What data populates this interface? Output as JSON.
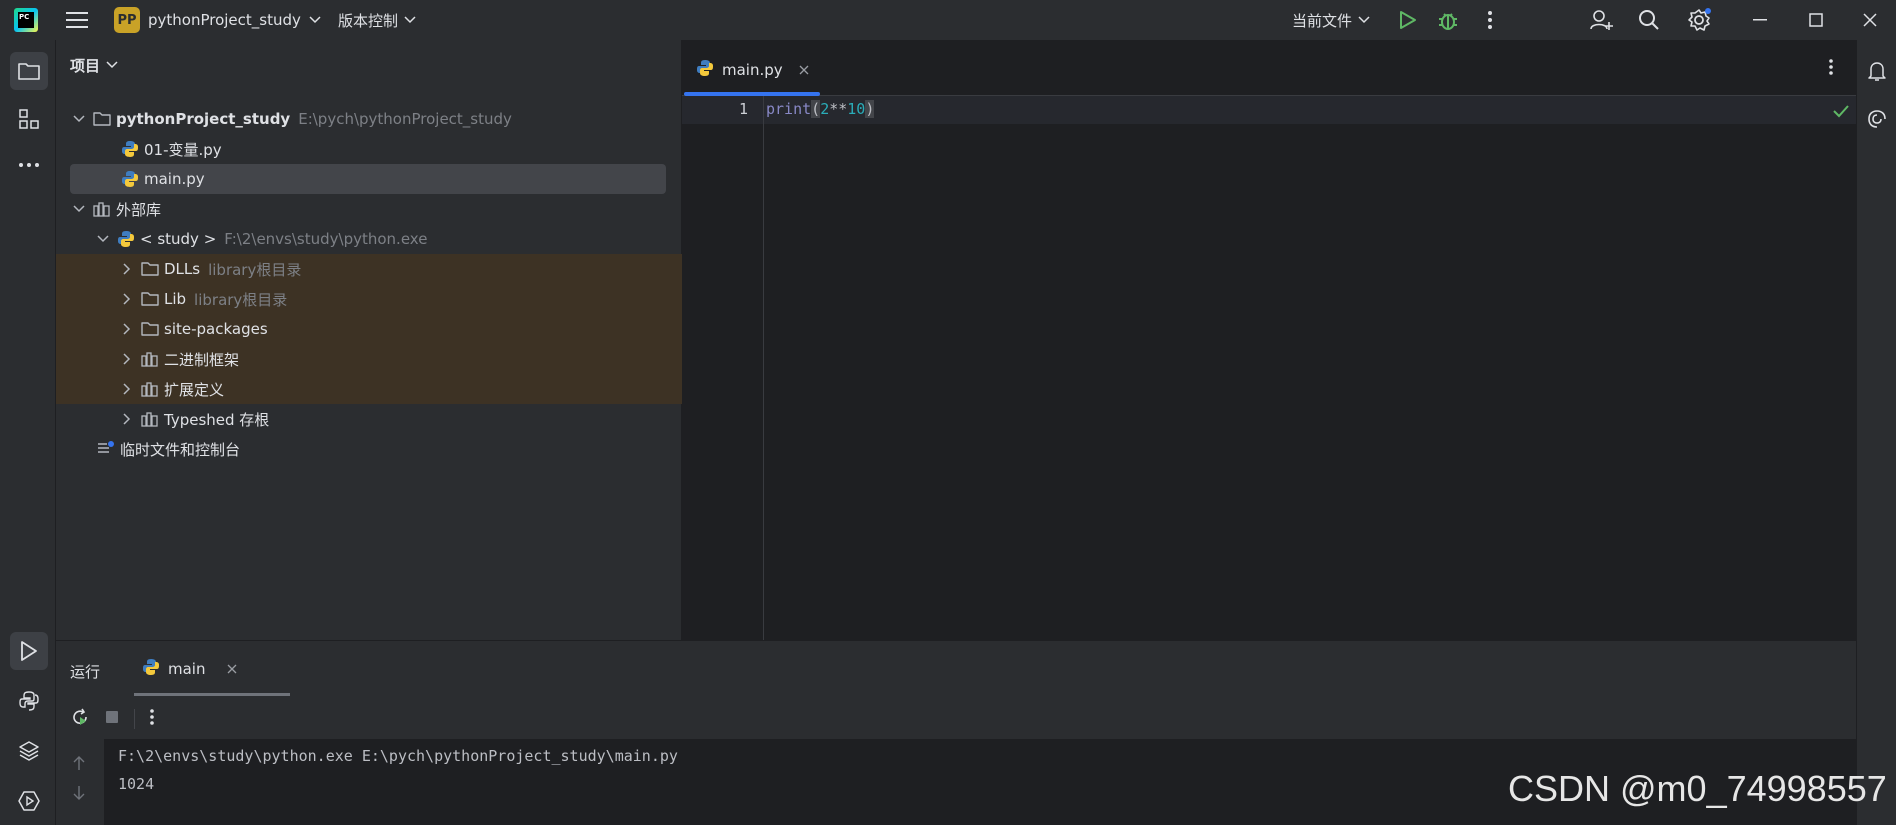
{
  "titlebar": {
    "app_logo_text": "PC",
    "project_badge": "PP",
    "project_name": "pythonProject_study",
    "vcs_label": "版本控制",
    "run_config_label": "当前文件"
  },
  "project_panel": {
    "header": "项目",
    "tree": [
      {
        "label": "pythonProject_study",
        "hint": "E:\\pych\\pythonProject_study"
      },
      {
        "label": "01-变量.py",
        "hint": ""
      },
      {
        "label": "main.py",
        "hint": ""
      },
      {
        "label": "外部库",
        "hint": ""
      },
      {
        "label": "< study >",
        "hint": "F:\\2\\envs\\study\\python.exe"
      },
      {
        "label": "DLLs",
        "hint": "library根目录"
      },
      {
        "label": "Lib",
        "hint": "library根目录"
      },
      {
        "label": "site-packages",
        "hint": ""
      },
      {
        "label": "二进制框架",
        "hint": ""
      },
      {
        "label": "扩展定义",
        "hint": ""
      },
      {
        "label": "Typeshed 存根",
        "hint": ""
      },
      {
        "label": "临时文件和控制台",
        "hint": ""
      }
    ]
  },
  "editor": {
    "tab_label": "main.py",
    "line_number": "1",
    "code": {
      "fn": "print",
      "open": "(",
      "num1": "2",
      "op": "**",
      "num2": "10",
      "close": ")"
    }
  },
  "run_panel": {
    "title": "运行",
    "tab_label": "main",
    "console_lines": [
      "F:\\2\\envs\\study\\python.exe E:\\pych\\pythonProject_study\\main.py",
      "1024"
    ]
  },
  "watermark": "CSDN @m0_74998557",
  "colors": {
    "accent": "#3574f0",
    "run_green": "#5fb865",
    "library_bg": "#3d3224"
  }
}
